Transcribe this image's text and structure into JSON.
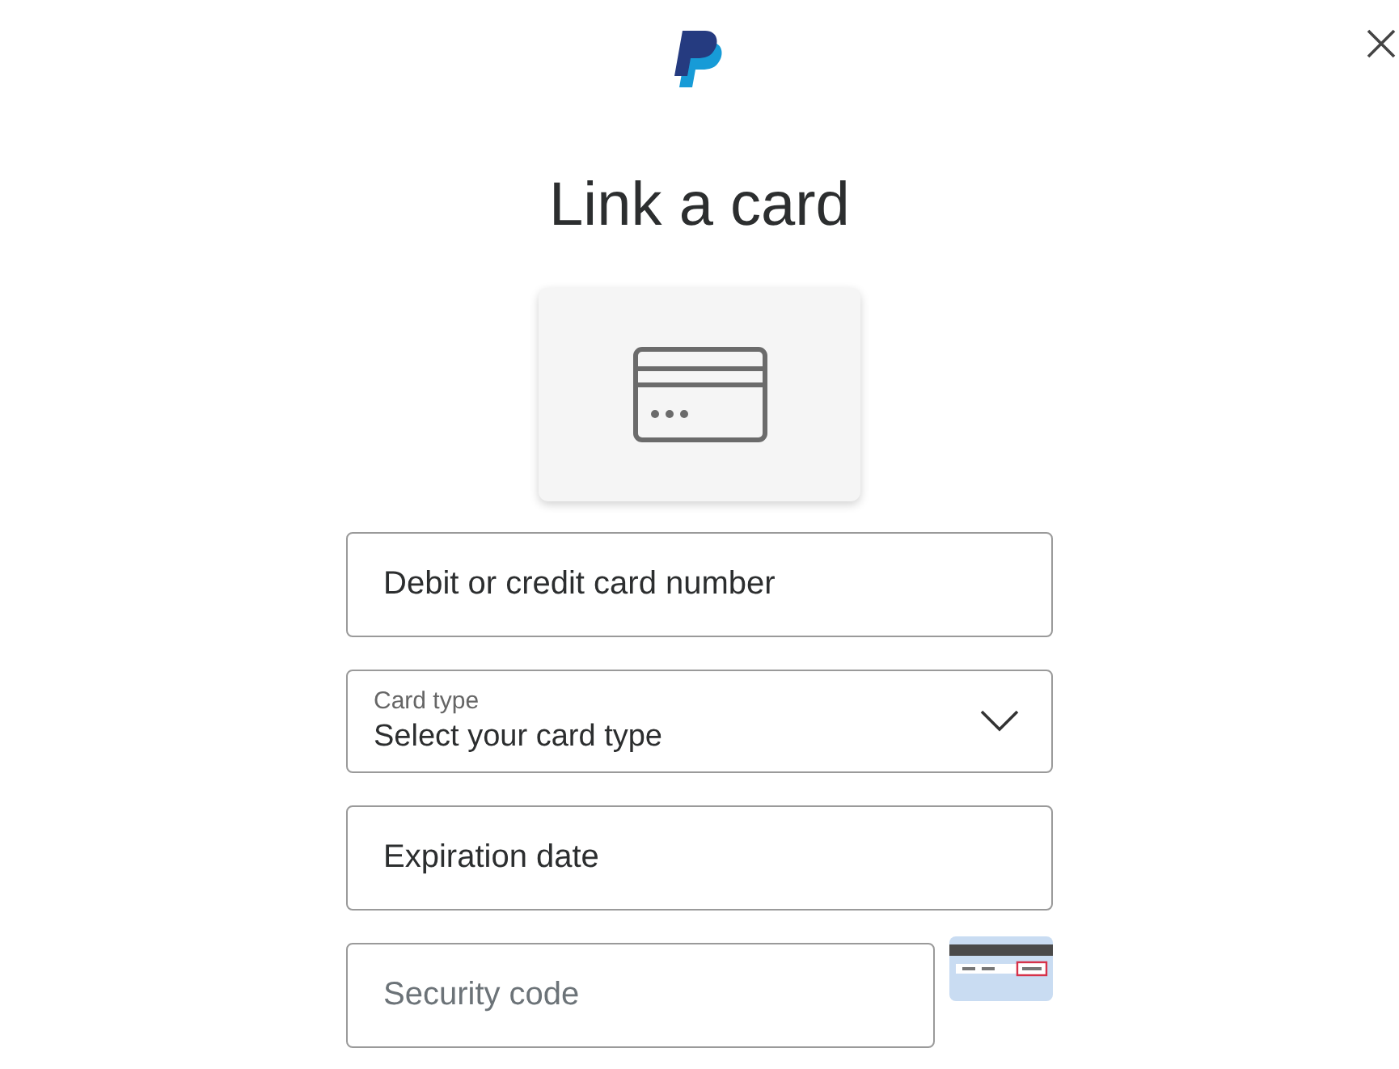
{
  "title": "Link a card",
  "fields": [
    {
      "kind": "input",
      "placeholder": "Debit or credit card number"
    },
    {
      "kind": "select",
      "label": "Card type",
      "value": "Select your card type"
    },
    {
      "kind": "input",
      "placeholder": "Expiration date"
    },
    {
      "kind": "security",
      "placeholder": "Security code"
    }
  ]
}
